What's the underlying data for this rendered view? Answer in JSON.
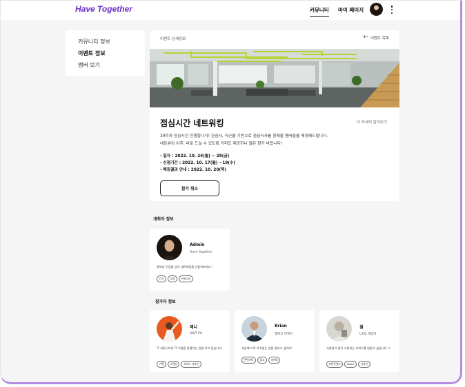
{
  "header": {
    "logo": "Have Together",
    "nav": {
      "community": "커뮤니티",
      "mypage": "마이 페이지"
    }
  },
  "sidebar": {
    "items": [
      {
        "label": "커뮤니티 정보",
        "active": false
      },
      {
        "label": "이벤트 정보",
        "active": true
      },
      {
        "label": "멤버 보기",
        "active": false
      }
    ]
  },
  "event": {
    "breadcrumb": "이벤트 상세정보",
    "back_label": "이벤트 목록",
    "title": "점심시간 네트워킹",
    "more_label": "더 자세히 알아보기",
    "description_1": "39주차 점심시간 진행합니다! 관심사, 직군을 기반으로 점심식사를 함께할 멤버들을 매칭해드립니다.",
    "description_2": "네트워킹 이후, 바로 드실 수 있도록 커피도 제공하니 많은 참가 바랍니다!",
    "detail_date": "- 일자 : 2022. 10. 24(월) ~ 28(금)",
    "detail_apply": "- 신청기간 : 2022. 10. 17(월) ~19(수)",
    "detail_result": "- 매칭결과 안내 : 2022. 10. 20(목)",
    "cancel_label": "참가 취소"
  },
  "host_section": {
    "title": "개최자 정보",
    "host": {
      "name": "Admin",
      "role": "Have Together",
      "bio": "행복과 건강을 성어 네트워킹을 만들어보아요 !",
      "tags": [
        "건시",
        "성장",
        "커뮤니티"
      ]
    }
  },
  "participants_section": {
    "title": "참가자 정보",
    "participants": [
      {
        "name": "제니",
        "role": "UNIT PO",
        "bio": "IT 커뮤니티와 IT 기업을 연결하는 일을 하고 있습니다.",
        "tags": [
          "기획",
          "브랜딩",
          "서비스 디자인"
        ]
      },
      {
        "name": "Brian",
        "role": "웹퍼크 마케터",
        "bio": "세상에 더욱 가치있는 일을 알리고 싶어요!",
        "tags": [
          "콘텐츠팀",
          "광고",
          "마케팅"
        ]
      },
      {
        "name": "샘",
        "role": "UX팀 개발자",
        "bio": "사람들이 많이 사용하는 서비스를 만들고 싶습니다 :)",
        "tags": [
          "프론트엔드",
          "React",
          "디자인"
        ]
      }
    ]
  },
  "colors": {
    "brand": "#6b2fc4",
    "frame_accent": "#b58de0",
    "background": "#f5f5f5"
  }
}
